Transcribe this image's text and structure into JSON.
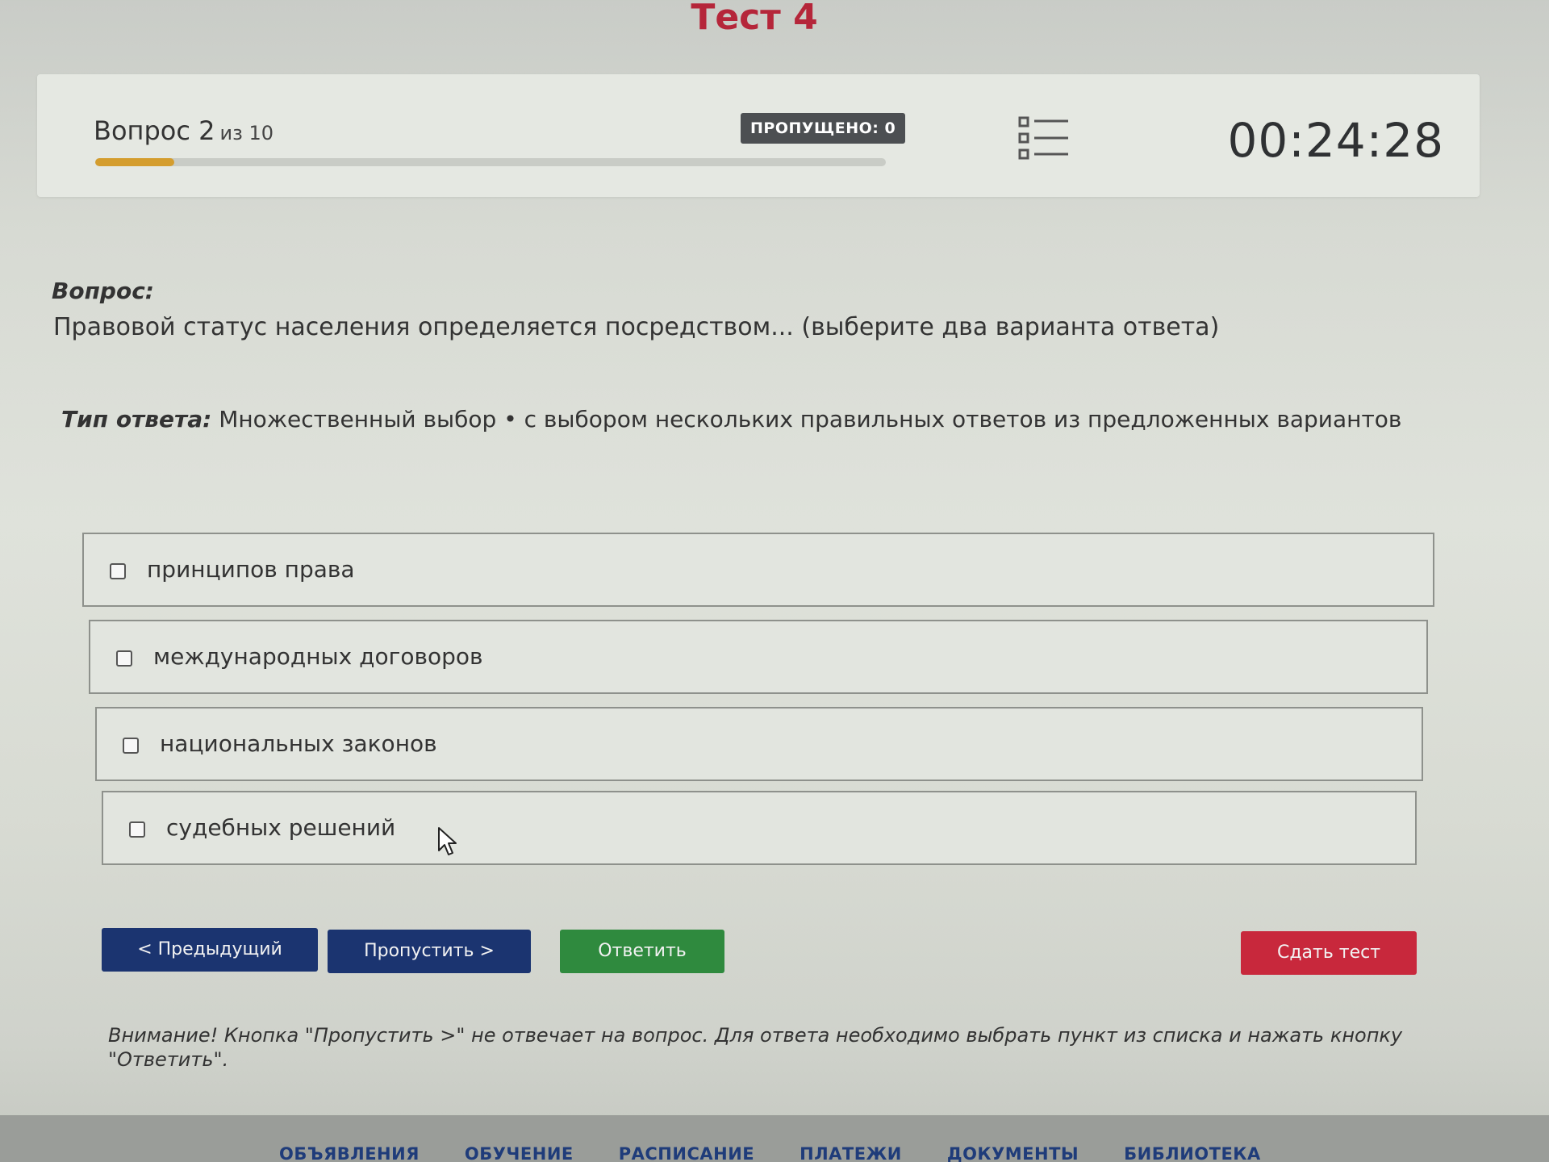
{
  "page_title": "Тест 4",
  "header": {
    "question_label": "Вопрос 2",
    "question_of": "из 10",
    "progress_fraction": 0.1,
    "skipped_badge": "ПРОПУЩЕНО: 0",
    "list_icon": "question-list-icon",
    "timer": "00:24:28"
  },
  "question": {
    "heading": "Вопрос:",
    "text": "Правовой статус населения определяется посредством... (выберите два варианта ответа)"
  },
  "answer_type": {
    "label": "Тип ответа:",
    "value": "Множественный выбор • с выбором нескольких правильных ответов из предложенных вариантов"
  },
  "options": [
    {
      "label": "принципов права",
      "checked": false
    },
    {
      "label": "международных договоров",
      "checked": false
    },
    {
      "label": "национальных законов",
      "checked": false
    },
    {
      "label": "судебных решений",
      "checked": false
    }
  ],
  "buttons": {
    "prev": "< Предыдущий",
    "skip": "Пропустить >",
    "answer": "Ответить",
    "submit": "Сдать тест"
  },
  "warning": "Внимание! Кнопка \"Пропустить >\" не отвечает на вопрос. Для ответа необходимо выбрать пункт из списка и нажать кнопку \"Ответить\".",
  "footer_nav": [
    "ОБЪЯВЛЕНИЯ",
    "ОБУЧЕНИЕ",
    "РАСПИСАНИЕ",
    "ПЛАТЕЖИ",
    "ДОКУМЕНТЫ",
    "БИБЛИОТЕКА"
  ],
  "colors": {
    "title": "#b5263a",
    "progress": "#d49d2e",
    "primary_button": "#1b3470",
    "answer_button": "#2f8a3e",
    "submit_button": "#c8283c"
  }
}
